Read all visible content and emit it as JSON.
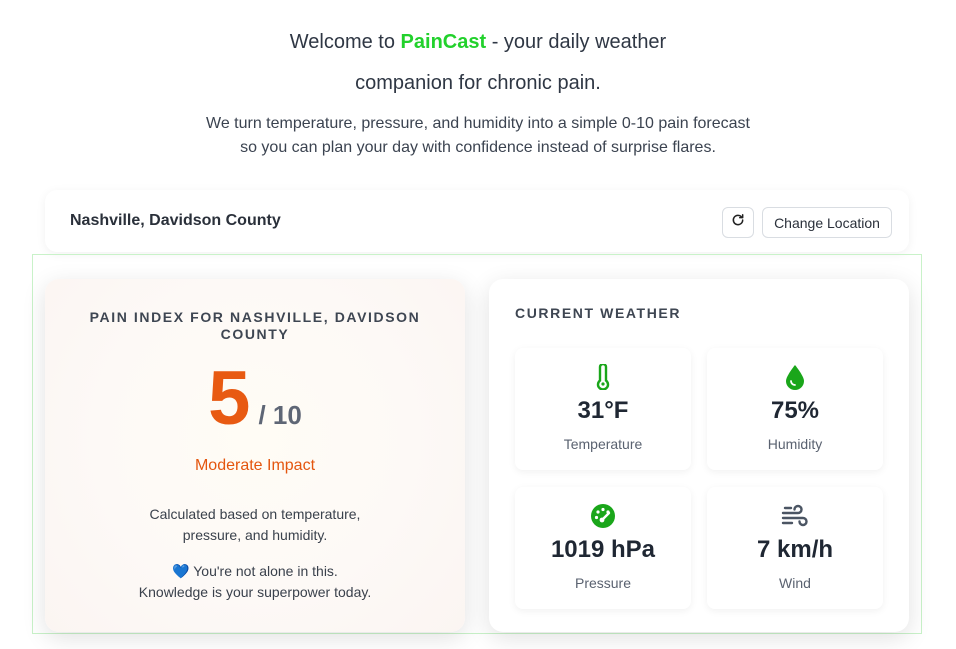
{
  "intro": {
    "welcome_prefix": "Welcome to ",
    "brand": "PainCast",
    "welcome_suffix": " - your daily weather",
    "welcome_line2": "companion for chronic pain.",
    "tagline": "We turn temperature, pressure, and humidity into a simple 0-10 pain forecast so you can plan your day with confidence instead of surprise flares."
  },
  "location": {
    "name": "Nashville, Davidson County",
    "refresh_icon": "refresh-icon",
    "change_label": "Change Location"
  },
  "pain": {
    "title": "PAIN INDEX FOR NASHVILLE, DAVIDSON COUNTY",
    "score": "5",
    "max": "/ 10",
    "impact": "Moderate Impact",
    "calc_note": "Calculated based on temperature, pressure, and humidity.",
    "heart": "💙",
    "support_line1": " You're not alone in this.",
    "support_line2": "Knowledge is your superpower today."
  },
  "weather": {
    "title": "CURRENT WEATHER",
    "tiles": [
      {
        "icon": "thermometer-icon",
        "value": "31°F",
        "label": "Temperature"
      },
      {
        "icon": "droplet-icon",
        "value": "75%",
        "label": "Humidity"
      },
      {
        "icon": "gauge-icon",
        "value": "1019 hPa",
        "label": "Pressure"
      },
      {
        "icon": "wind-icon",
        "value": "7 km/h",
        "label": "Wind"
      }
    ]
  },
  "colors": {
    "brand": "#22d12c",
    "score": "#e85a12",
    "icon_green": "#1aa61a"
  }
}
